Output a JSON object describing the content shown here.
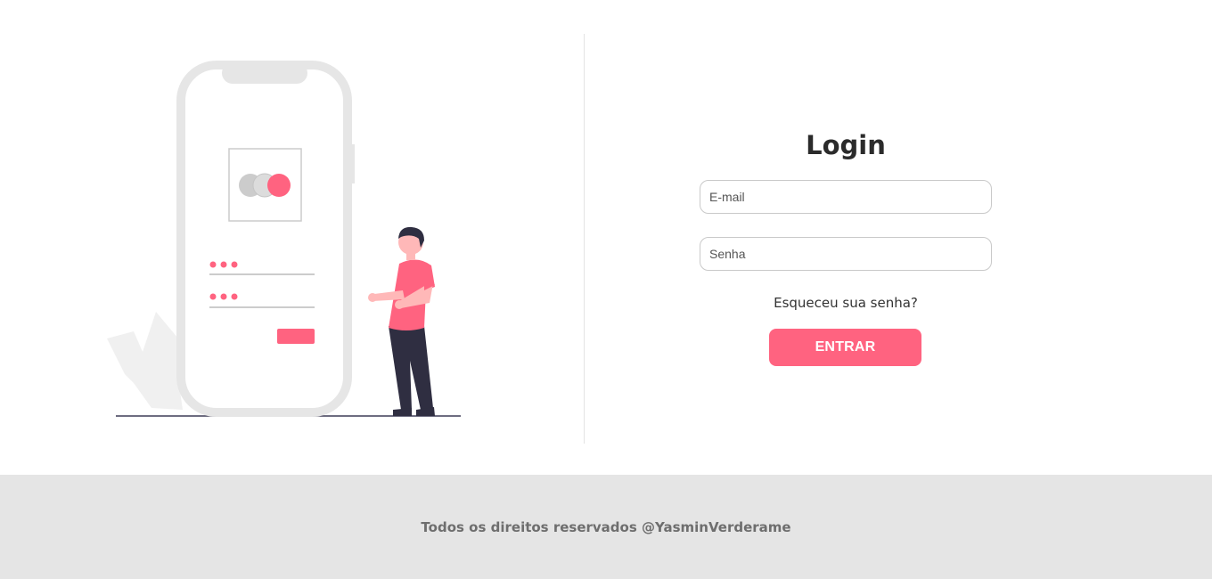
{
  "login": {
    "title": "Login",
    "email_placeholder": "E-mail",
    "password_placeholder": "Senha",
    "forgot_password": "Esqueceu sua senha?",
    "submit_label": "ENTRAR"
  },
  "footer": {
    "text": "Todos os direitos reservados @YasminVerderame"
  },
  "colors": {
    "accent": "#ff6380",
    "title": "#2b2b2b",
    "footer_bg": "#e5e5e5",
    "footer_text": "#6e6e6e",
    "illustration_gray": "#e6e6e6",
    "figure_dark": "#2f2e41"
  }
}
